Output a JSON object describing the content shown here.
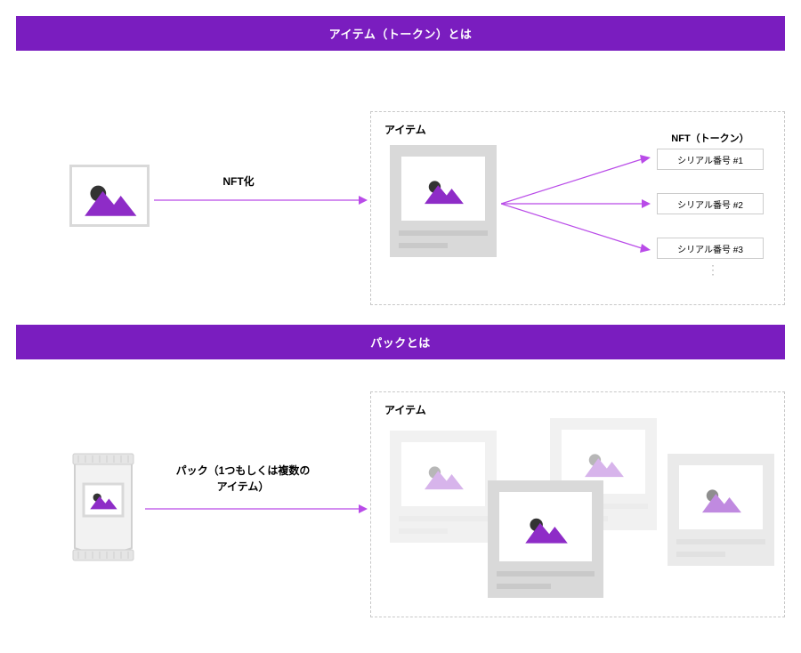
{
  "section1": {
    "header": "アイテム（トークン）とは",
    "arrow_label": "NFT化",
    "dashed_label": "アイテム",
    "serials": {
      "title": "NFT（トークン）",
      "items": [
        "シリアル番号 #1",
        "シリアル番号 #2",
        "シリアル番号 #3"
      ]
    }
  },
  "section2": {
    "header": "パックとは",
    "arrow_label": "パック（1つもしくは複数のアイテム）",
    "dashed_label": "アイテム"
  },
  "colors": {
    "purple": "#7A1DBF",
    "magenta": "#B94BE8",
    "grey": "#d9d9d9"
  }
}
